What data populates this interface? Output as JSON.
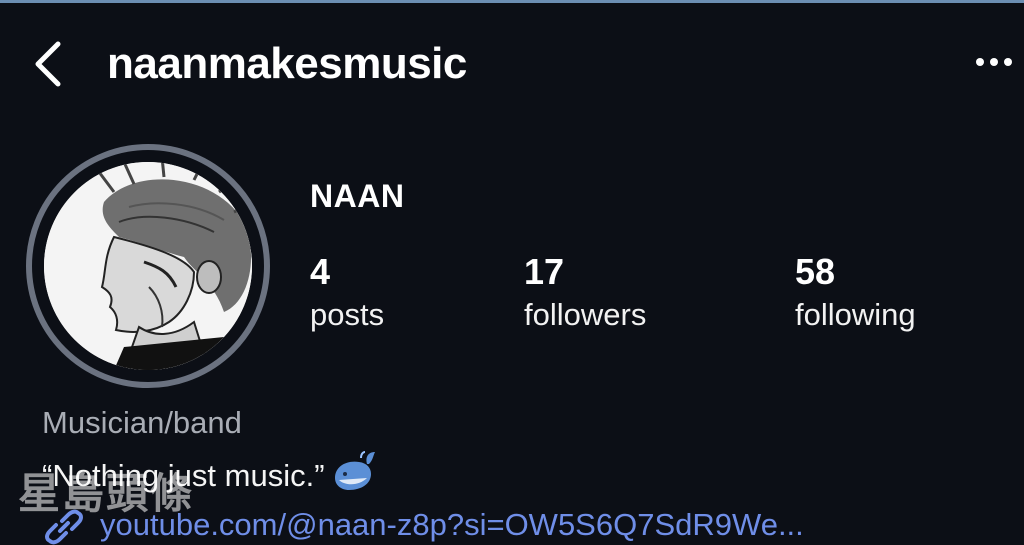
{
  "header": {
    "back_icon": "chevron-left-icon",
    "username": "naanmakesmusic",
    "more_icon": "more-horizontal-icon"
  },
  "profile": {
    "display_name": "NAAN",
    "stats": [
      {
        "value": "4",
        "label": "posts"
      },
      {
        "value": "17",
        "label": "followers"
      },
      {
        "value": "58",
        "label": "following"
      }
    ],
    "category": "Musician/band",
    "bio": "“Nothing just music.”",
    "bio_emoji": "whale-icon",
    "link_icon": "link-icon",
    "link": "youtube.com/@naan-z8p?si=OW5S6Q7SdR9We..."
  },
  "watermark": "星島頭條",
  "colors": {
    "background": "#0c0f16",
    "link": "#6f8ee8",
    "muted": "#a9adb5"
  }
}
